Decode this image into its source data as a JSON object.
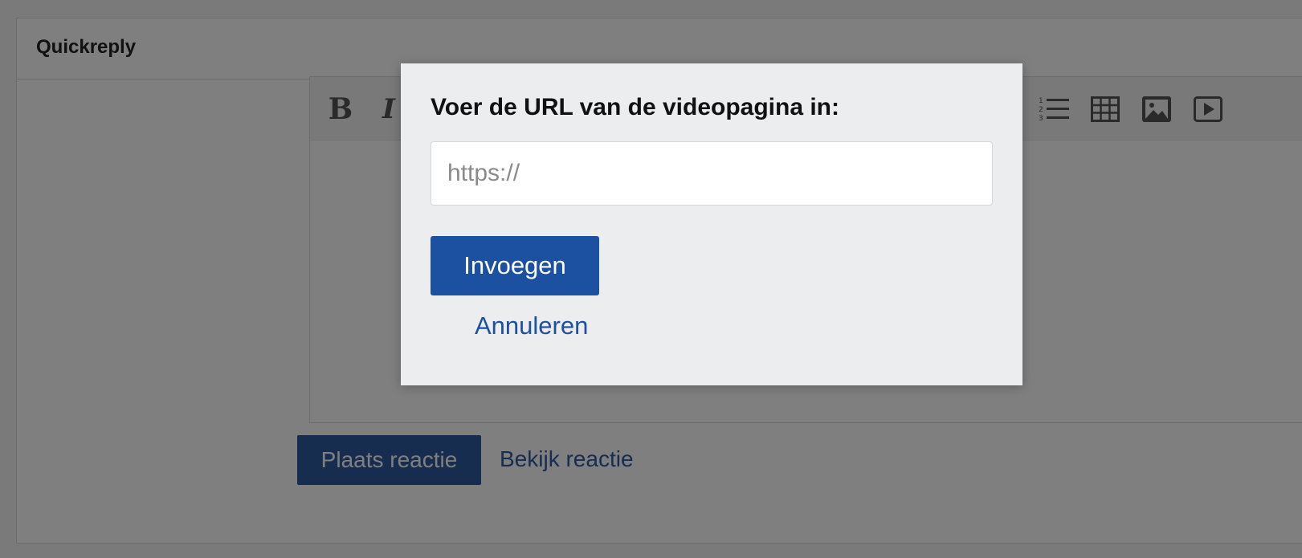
{
  "panel": {
    "title": "Quickreply"
  },
  "editor": {
    "toolbar": {
      "bold_glyph": "B",
      "italic_glyph": "I",
      "icons": [
        "bullet-list-icon",
        "numbered-list-icon",
        "table-icon",
        "image-icon",
        "video-icon"
      ]
    }
  },
  "actions": {
    "post_label": "Plaats reactie",
    "preview_label": "Bekijk reactie"
  },
  "modal": {
    "label": "Voer de URL van de videopagina in:",
    "input_placeholder": "https://",
    "input_value": "",
    "insert_label": "Invoegen",
    "cancel_label": "Annuleren"
  },
  "colors": {
    "primary": "#1c50a0",
    "overlay": "rgba(0,0,0,0.5)",
    "modal_bg": "#ecedef"
  }
}
